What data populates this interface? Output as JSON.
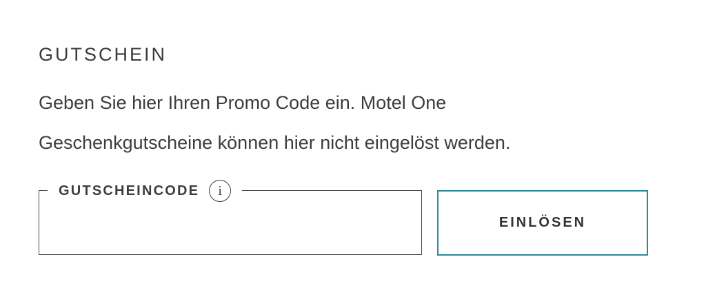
{
  "voucher": {
    "title": "GUTSCHEIN",
    "description_line1": "Geben Sie hier Ihren Promo Code ein. Motel One",
    "description_line2": "Geschenkgutscheine können hier nicht eingelöst werden.",
    "code_field": {
      "label": "GUTSCHEINCODE",
      "info_icon_glyph": "i",
      "value": "",
      "placeholder": ""
    },
    "redeem_button_label": "EINLÖSEN",
    "accent_color": "#2b8896"
  }
}
